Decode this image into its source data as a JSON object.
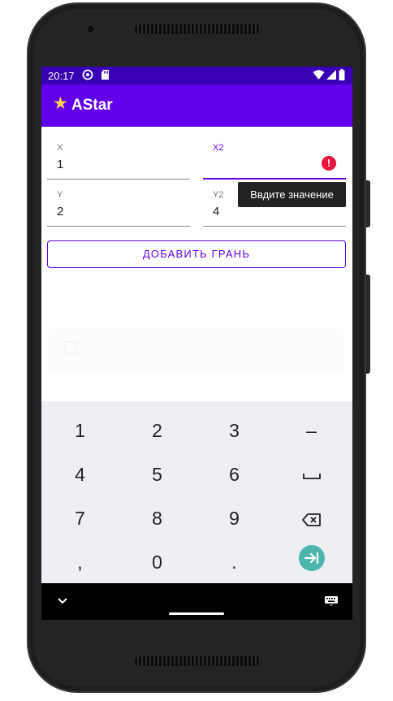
{
  "status": {
    "time": "20:17"
  },
  "app": {
    "title": "AStar"
  },
  "form": {
    "x": {
      "label": "X",
      "value": "1"
    },
    "x2": {
      "label": "X2",
      "value": ""
    },
    "y": {
      "label": "Y",
      "value": "2"
    },
    "y2": {
      "label": "Y2",
      "value": "4"
    },
    "error_tooltip": "Ввдите значение",
    "add_button": "ДОБАВИТЬ ГРАНЬ"
  },
  "keyboard": {
    "rows": [
      [
        "1",
        "2",
        "3",
        "–"
      ],
      [
        "4",
        "5",
        "6",
        "␣"
      ],
      [
        "7",
        "8",
        "9",
        "⌫"
      ],
      [
        ",",
        "0",
        ".",
        "⇥"
      ]
    ]
  },
  "colors": {
    "status_bar": "#3700b3",
    "app_bar": "#6200ee",
    "accent": "#6200ee",
    "error": "#e8143c",
    "enter_key": "#4db6ac"
  },
  "icons": {
    "status": [
      "do-not-disturb-icon",
      "sd-card-icon",
      "wifi-icon",
      "signal-icon",
      "battery-icon"
    ],
    "app": "star-icon",
    "nav": [
      "nav-collapse-icon",
      "keyboard-switch-icon"
    ]
  }
}
